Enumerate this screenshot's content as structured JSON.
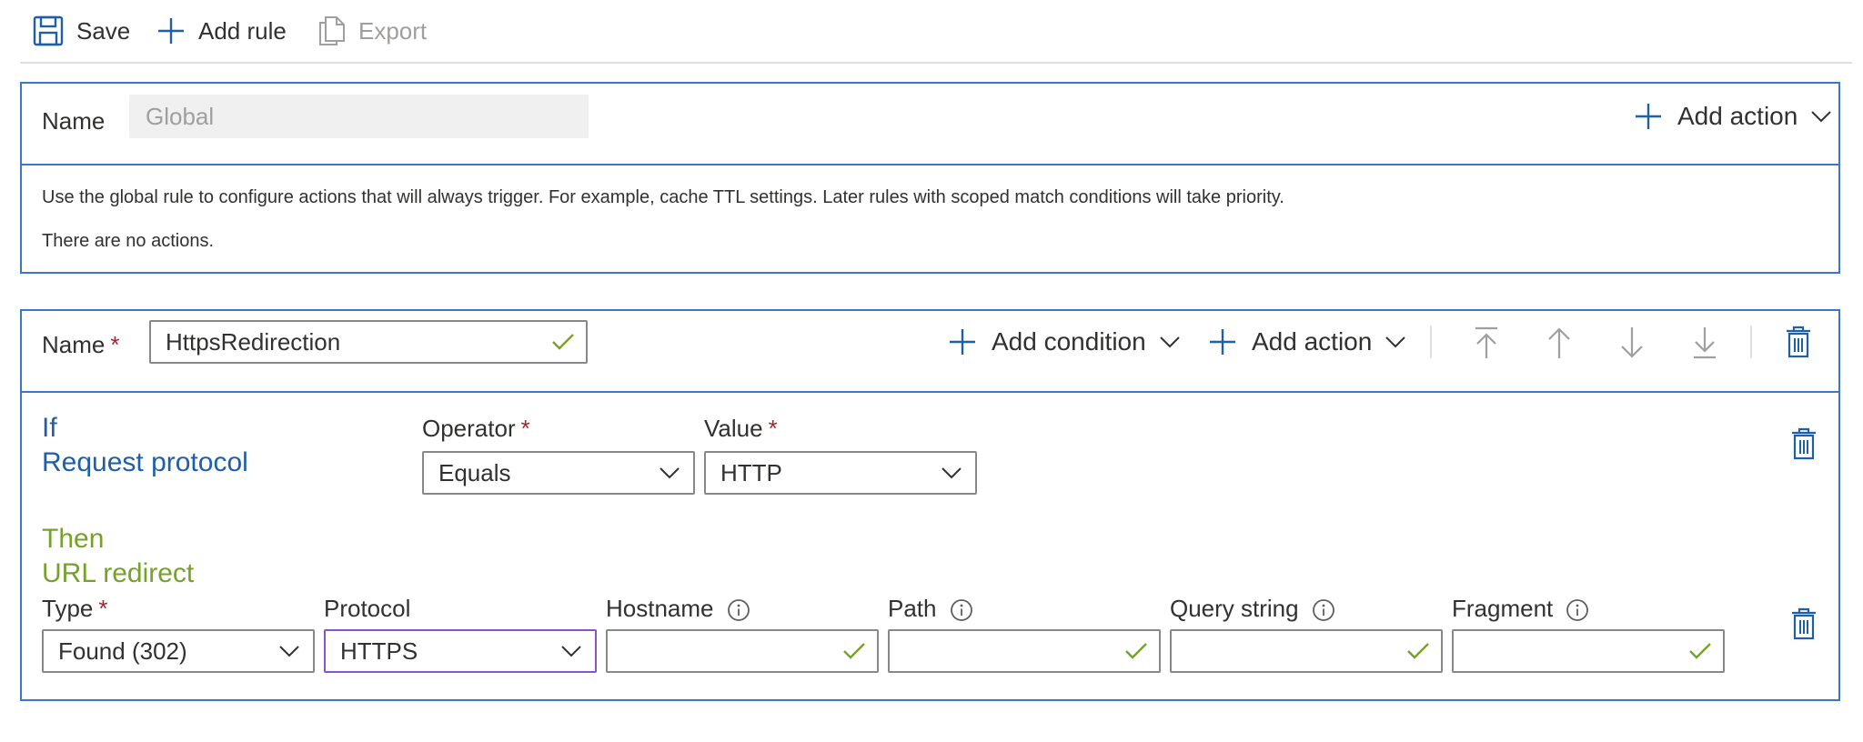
{
  "toolbar": {
    "save_label": "Save",
    "add_rule_label": "Add rule",
    "export_label": "Export"
  },
  "global_rule": {
    "name_label": "Name",
    "name_value": "Global",
    "add_action_label": "Add action",
    "description": "Use the global rule to configure actions that will always trigger. For example, cache TTL settings. Later rules with scoped match conditions will take priority.",
    "no_actions_text": "There are no actions."
  },
  "rule": {
    "name_label": "Name",
    "required_mark": "*",
    "name_value": "HttpsRedirection",
    "add_condition_label": "Add condition",
    "add_action_label": "Add action",
    "condition": {
      "if_label": "If",
      "condition_name": "Request protocol",
      "operator_label": "Operator",
      "operator_value": "Equals",
      "value_label": "Value",
      "value_value": "HTTP"
    },
    "action": {
      "then_label": "Then",
      "action_name": "URL redirect",
      "type_label": "Type",
      "type_value": "Found (302)",
      "protocol_label": "Protocol",
      "protocol_value": "HTTPS",
      "hostname_label": "Hostname",
      "path_label": "Path",
      "query_string_label": "Query string",
      "fragment_label": "Fragment"
    }
  },
  "colors": {
    "accent": "#3a78c6",
    "blue_text": "#1f5fa8",
    "green_text": "#76a22a",
    "required": "#a4262c",
    "focus": "#8a54c8"
  },
  "icons": [
    "save-icon",
    "plus-icon",
    "export-icon",
    "chevron-down-icon",
    "check-icon",
    "move-top-icon",
    "move-up-icon",
    "move-down-icon",
    "move-bottom-icon",
    "delete-icon",
    "info-icon"
  ]
}
